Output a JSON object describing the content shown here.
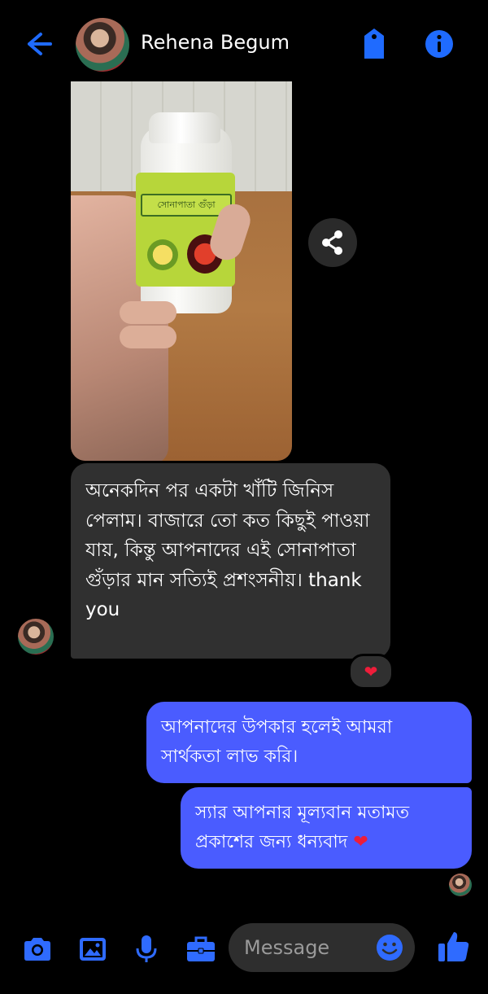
{
  "header": {
    "contact_name": "Rehena Begum",
    "icons": [
      "back-arrow-icon",
      "tag-icon",
      "info-icon"
    ]
  },
  "photo_message": {
    "label_text": "সোনাপাতা গুঁড়া",
    "share_icon": "share-icon"
  },
  "messages": [
    {
      "direction": "incoming",
      "text": "অনেকদিন পর একটা খাঁটি জিনিস পেলাম। বাজারে তো কত কিছুই পাওয়া যায়, কিন্তু আপনাদের এই সোনাপাতা গুঁড়ার মান সত্যিই প্রশংসনীয়। thank you",
      "reaction": "❤"
    },
    {
      "direction": "outgoing",
      "text": "আপনাদের উপকার হলেই আমরা সার্থকতা লাভ করি।"
    },
    {
      "direction": "outgoing",
      "text": "স্যার আপনার মূল্যবান মতামত প্রকাশের জন্য ধন্যবাদ",
      "emoji": "❤"
    }
  ],
  "composer": {
    "placeholder": "Message",
    "icons": [
      "camera-icon",
      "image-icon",
      "microphone-icon",
      "briefcase-icon",
      "emoji-icon",
      "thumbs-up-icon"
    ]
  },
  "colors": {
    "accent": "#0866ff",
    "outgoing_bubble": "#4a5cff",
    "incoming_bubble": "#303030",
    "background": "#000000",
    "reaction_heart": "#ee1d3a"
  }
}
